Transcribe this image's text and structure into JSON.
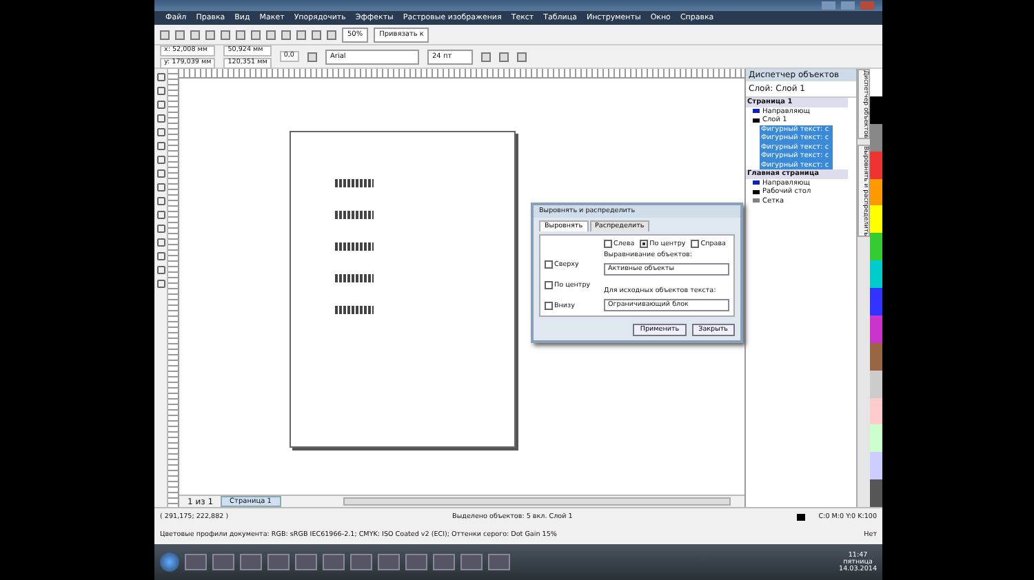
{
  "menu": [
    "Файл",
    "Правка",
    "Вид",
    "Макет",
    "Упорядочить",
    "Эффекты",
    "Растровые изображения",
    "Текст",
    "Таблица",
    "Инструменты",
    "Окно",
    "Справка"
  ],
  "toolbar": {
    "zoom": "50%",
    "snap": "Привязать к"
  },
  "property_bar": {
    "x_label": "x:",
    "y_label": "y:",
    "x": "52,008 мм",
    "y": "179,039 мм",
    "width": "50,924 мм",
    "height": "120,351 мм",
    "angle": "0,0",
    "font": "Arial",
    "size": "24 пт"
  },
  "dialog": {
    "title": "Выровнять и распределить",
    "tabs": [
      {
        "label": "Выровнять",
        "selected": true
      },
      {
        "label": "Распределить",
        "selected": false
      }
    ],
    "horizontal": [
      {
        "label": "Слева",
        "checked": false
      },
      {
        "label": "По центру",
        "checked": true
      },
      {
        "label": "Справа",
        "checked": false
      }
    ],
    "vertical": [
      {
        "label": "Сверху",
        "checked": false
      },
      {
        "label": "По центру",
        "checked": false
      },
      {
        "label": "Внизу",
        "checked": false
      }
    ],
    "align_to_label": "Выравнивание объектов:",
    "align_to": "Активные объекты",
    "text_label": "Для исходных объектов текста:",
    "text_source": "Ограничивающий блок",
    "buttons": [
      "Применить",
      "Закрыть"
    ]
  },
  "docker": {
    "title": "Диспетчер объектов",
    "layer_label": "Слой:",
    "layer": "Слой 1",
    "tree": [
      {
        "label": "Страница 1",
        "children": [
          {
            "label": "Направляющ",
            "selected": false,
            "color": "#1020c0"
          },
          {
            "label": "Слой 1",
            "selected": false,
            "color": "#000000",
            "children": [
              {
                "label": "Фигурный текст: с",
                "selected": true
              },
              {
                "label": "Фигурный текст: с",
                "selected": true
              },
              {
                "label": "Фигурный текст: с",
                "selected": true
              },
              {
                "label": "Фигурный текст: с",
                "selected": true
              },
              {
                "label": "Фигурный текст: с",
                "selected": true
              }
            ]
          }
        ]
      },
      {
        "label": "Главная страница",
        "children": [
          {
            "label": "Направляющ",
            "selected": false,
            "color": "#1020c0"
          },
          {
            "label": "Рабочий стол",
            "selected": false,
            "color": "#000000"
          },
          {
            "label": "Сетка",
            "selected": false,
            "color": "#808080"
          }
        ]
      }
    ],
    "side_tabs": [
      "Диспетчер объектов",
      "Выровнять и распределить"
    ]
  },
  "page_nav": {
    "count": "1 из 1",
    "tab": "Страница 1"
  },
  "status_bar": {
    "coords": "( 291,175; 222,882 )",
    "selection": "Выделено объектов: 5 вкл. Слой 1",
    "fill": "C:0 M:0 Y:0 K:100",
    "outline": "Нет",
    "profiles": "Цветовые профили документа: RGB: sRGB IEC61966-2.1; CMYK: ISO Coated v2 (ECI); Оттенки серого: Dot Gain 15%"
  },
  "taskbar": {
    "time": "11:47",
    "day": "пятница",
    "date": "14.03.2014"
  }
}
